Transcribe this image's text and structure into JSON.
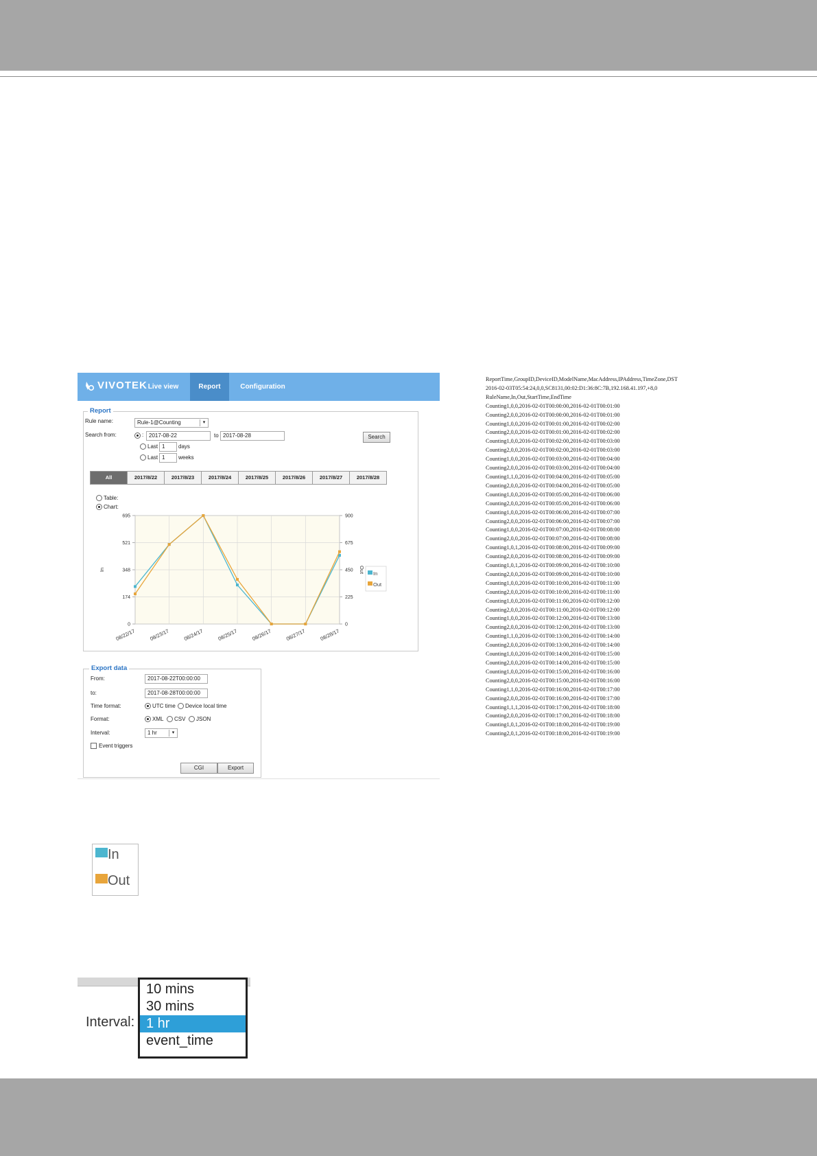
{
  "app": {
    "brand": "VIVOTEK",
    "nav": {
      "live_view": "Live view",
      "report": "Report",
      "configuration": "Configuration"
    },
    "accent_color": "#6fb0e8",
    "report": {
      "section_title": "Report",
      "rule_name_label": "Rule name:",
      "rule_name_value": "Rule-1@Counting",
      "search_from_label": "Search from:",
      "range_prefix": ":",
      "from_date": "2017-08-22",
      "to_label": "to",
      "to_date": "2017-08-28",
      "search_button": "Search",
      "last_label": "Last",
      "last_days_value": "1",
      "days_label": "days",
      "last_weeks_value": "1",
      "weeks_label": "weeks",
      "date_tabs": [
        "All",
        "2017/8/22",
        "2017/8/23",
        "2017/8/24",
        "2017/8/25",
        "2017/8/26",
        "2017/8/27",
        "2017/8/28"
      ],
      "view_table_label": "Table:",
      "view_chart_label": "Chart:"
    },
    "export": {
      "section_title": "Export data",
      "from_label": "From:",
      "from_value": "2017-08-22T00:00:00",
      "to_label": "to:",
      "to_value": "2017-08-28T00:00:00",
      "time_format_label": "Time format:",
      "utc_time": "UTC time",
      "device_local_time": "Device local time",
      "format_label": "Format:",
      "xml": "XML",
      "csv": "CSV",
      "json": "JSON",
      "interval_label": "Interval:",
      "interval_value": "1 hr",
      "event_triggers": "Event triggers",
      "cgi_button": "CGI",
      "export_button": "Export"
    }
  },
  "chart_data": {
    "type": "line",
    "categories": [
      "08/22/17",
      "08/23/17",
      "08/24/17",
      "08/25/17",
      "08/26/17",
      "08/27/17",
      "08/28/17"
    ],
    "series": [
      {
        "name": "In",
        "axis": "left",
        "color": "#4cb6cf",
        "values": [
          240,
          510,
          695,
          250,
          0,
          0,
          440
        ]
      },
      {
        "name": "Out",
        "axis": "right",
        "color": "#e8a53b",
        "values": [
          250,
          660,
          900,
          370,
          0,
          0,
          600
        ]
      }
    ],
    "y_left": {
      "label": "In",
      "ticks": [
        "0",
        "174",
        "348",
        "521",
        "695"
      ],
      "range": [
        0,
        695
      ]
    },
    "y_right": {
      "label": "Out",
      "ticks": [
        "0",
        "225",
        "450",
        "675",
        "900"
      ],
      "range": [
        0,
        900
      ]
    },
    "grid": true,
    "legend_placement": "right"
  },
  "log_lines": [
    "ReportTime,GroupID,DeviceID,ModelName,MacAddress,IPAddress,TimeZone,DST",
    "2016-02-03T05:54:24,0,0,SC8131,00:02:D1:36:8C:7B,192.168.41.197,+8,0",
    "RuleName,In,Out,StartTime,EndTime",
    "Counting1,0,0,2016-02-01T00:00:00,2016-02-01T00:01:00",
    "Counting2,0,0,2016-02-01T00:00:00,2016-02-01T00:01:00",
    "Counting1,0,0,2016-02-01T00:01:00,2016-02-01T00:02:00",
    "Counting2,0,0,2016-02-01T00:01:00,2016-02-01T00:02:00",
    "Counting1,0,0,2016-02-01T00:02:00,2016-02-01T00:03:00",
    "Counting2,0,0,2016-02-01T00:02:00,2016-02-01T00:03:00",
    "Counting1,0,0,2016-02-01T00:03:00,2016-02-01T00:04:00",
    "Counting2,0,0,2016-02-01T00:03:00,2016-02-01T00:04:00",
    "Counting1,1,0,2016-02-01T00:04:00,2016-02-01T00:05:00",
    "Counting2,0,0,2016-02-01T00:04:00,2016-02-01T00:05:00",
    "Counting1,0,0,2016-02-01T00:05:00,2016-02-01T00:06:00",
    "Counting2,0,0,2016-02-01T00:05:00,2016-02-01T00:06:00",
    "Counting1,0,0,2016-02-01T00:06:00,2016-02-01T00:07:00",
    "Counting2,0,0,2016-02-01T00:06:00,2016-02-01T00:07:00",
    "Counting1,0,0,2016-02-01T00:07:00,2016-02-01T00:08:00",
    "Counting2,0,0,2016-02-01T00:07:00,2016-02-01T00:08:00",
    "Counting1,0,1,2016-02-01T00:08:00,2016-02-01T00:09:00",
    "Counting2,0,0,2016-02-01T00:08:00,2016-02-01T00:09:00",
    "Counting1,0,1,2016-02-01T00:09:00,2016-02-01T00:10:00",
    "Counting2,0,0,2016-02-01T00:09:00,2016-02-01T00:10:00",
    "Counting1,0,0,2016-02-01T00:10:00,2016-02-01T00:11:00",
    "Counting2,0,0,2016-02-01T00:10:00,2016-02-01T00:11:00",
    "Counting1,0,0,2016-02-01T00:11:00,2016-02-01T00:12:00",
    "Counting2,0,0,2016-02-01T00:11:00,2016-02-01T00:12:00",
    "Counting1,0,0,2016-02-01T00:12:00,2016-02-01T00:13:00",
    "Counting2,0,0,2016-02-01T00:12:00,2016-02-01T00:13:00",
    "Counting1,1,0,2016-02-01T00:13:00,2016-02-01T00:14:00",
    "Counting2,0,0,2016-02-01T00:13:00,2016-02-01T00:14:00",
    "Counting1,0,0,2016-02-01T00:14:00,2016-02-01T00:15:00",
    "Counting2,0,0,2016-02-01T00:14:00,2016-02-01T00:15:00",
    "Counting1,0,0,2016-02-01T00:15:00,2016-02-01T00:16:00",
    "Counting2,0,0,2016-02-01T00:15:00,2016-02-01T00:16:00",
    "Counting1,1,0,2016-02-01T00:16:00,2016-02-01T00:17:00",
    "Counting2,0,0,2016-02-01T00:16:00,2016-02-01T00:17:00",
    "Counting1,1,1,2016-02-01T00:17:00,2016-02-01T00:18:00",
    "Counting2,0,0,2016-02-01T00:17:00,2016-02-01T00:18:00",
    "Counting1,0,1,2016-02-01T00:18:00,2016-02-01T00:19:00",
    "Counting2,0,1,2016-02-01T00:18:00,2016-02-01T00:19:00"
  ],
  "zoom_legend": {
    "in": "In",
    "out": "Out",
    "in_color": "#4cb6cf",
    "out_color": "#e8a53b"
  },
  "zoom_interval": {
    "label": "Interval:",
    "options": [
      "10 mins",
      "30 mins",
      "1 hr",
      "event_time"
    ],
    "selected": "1 hr",
    "selected_color": "#2e9fd8"
  }
}
